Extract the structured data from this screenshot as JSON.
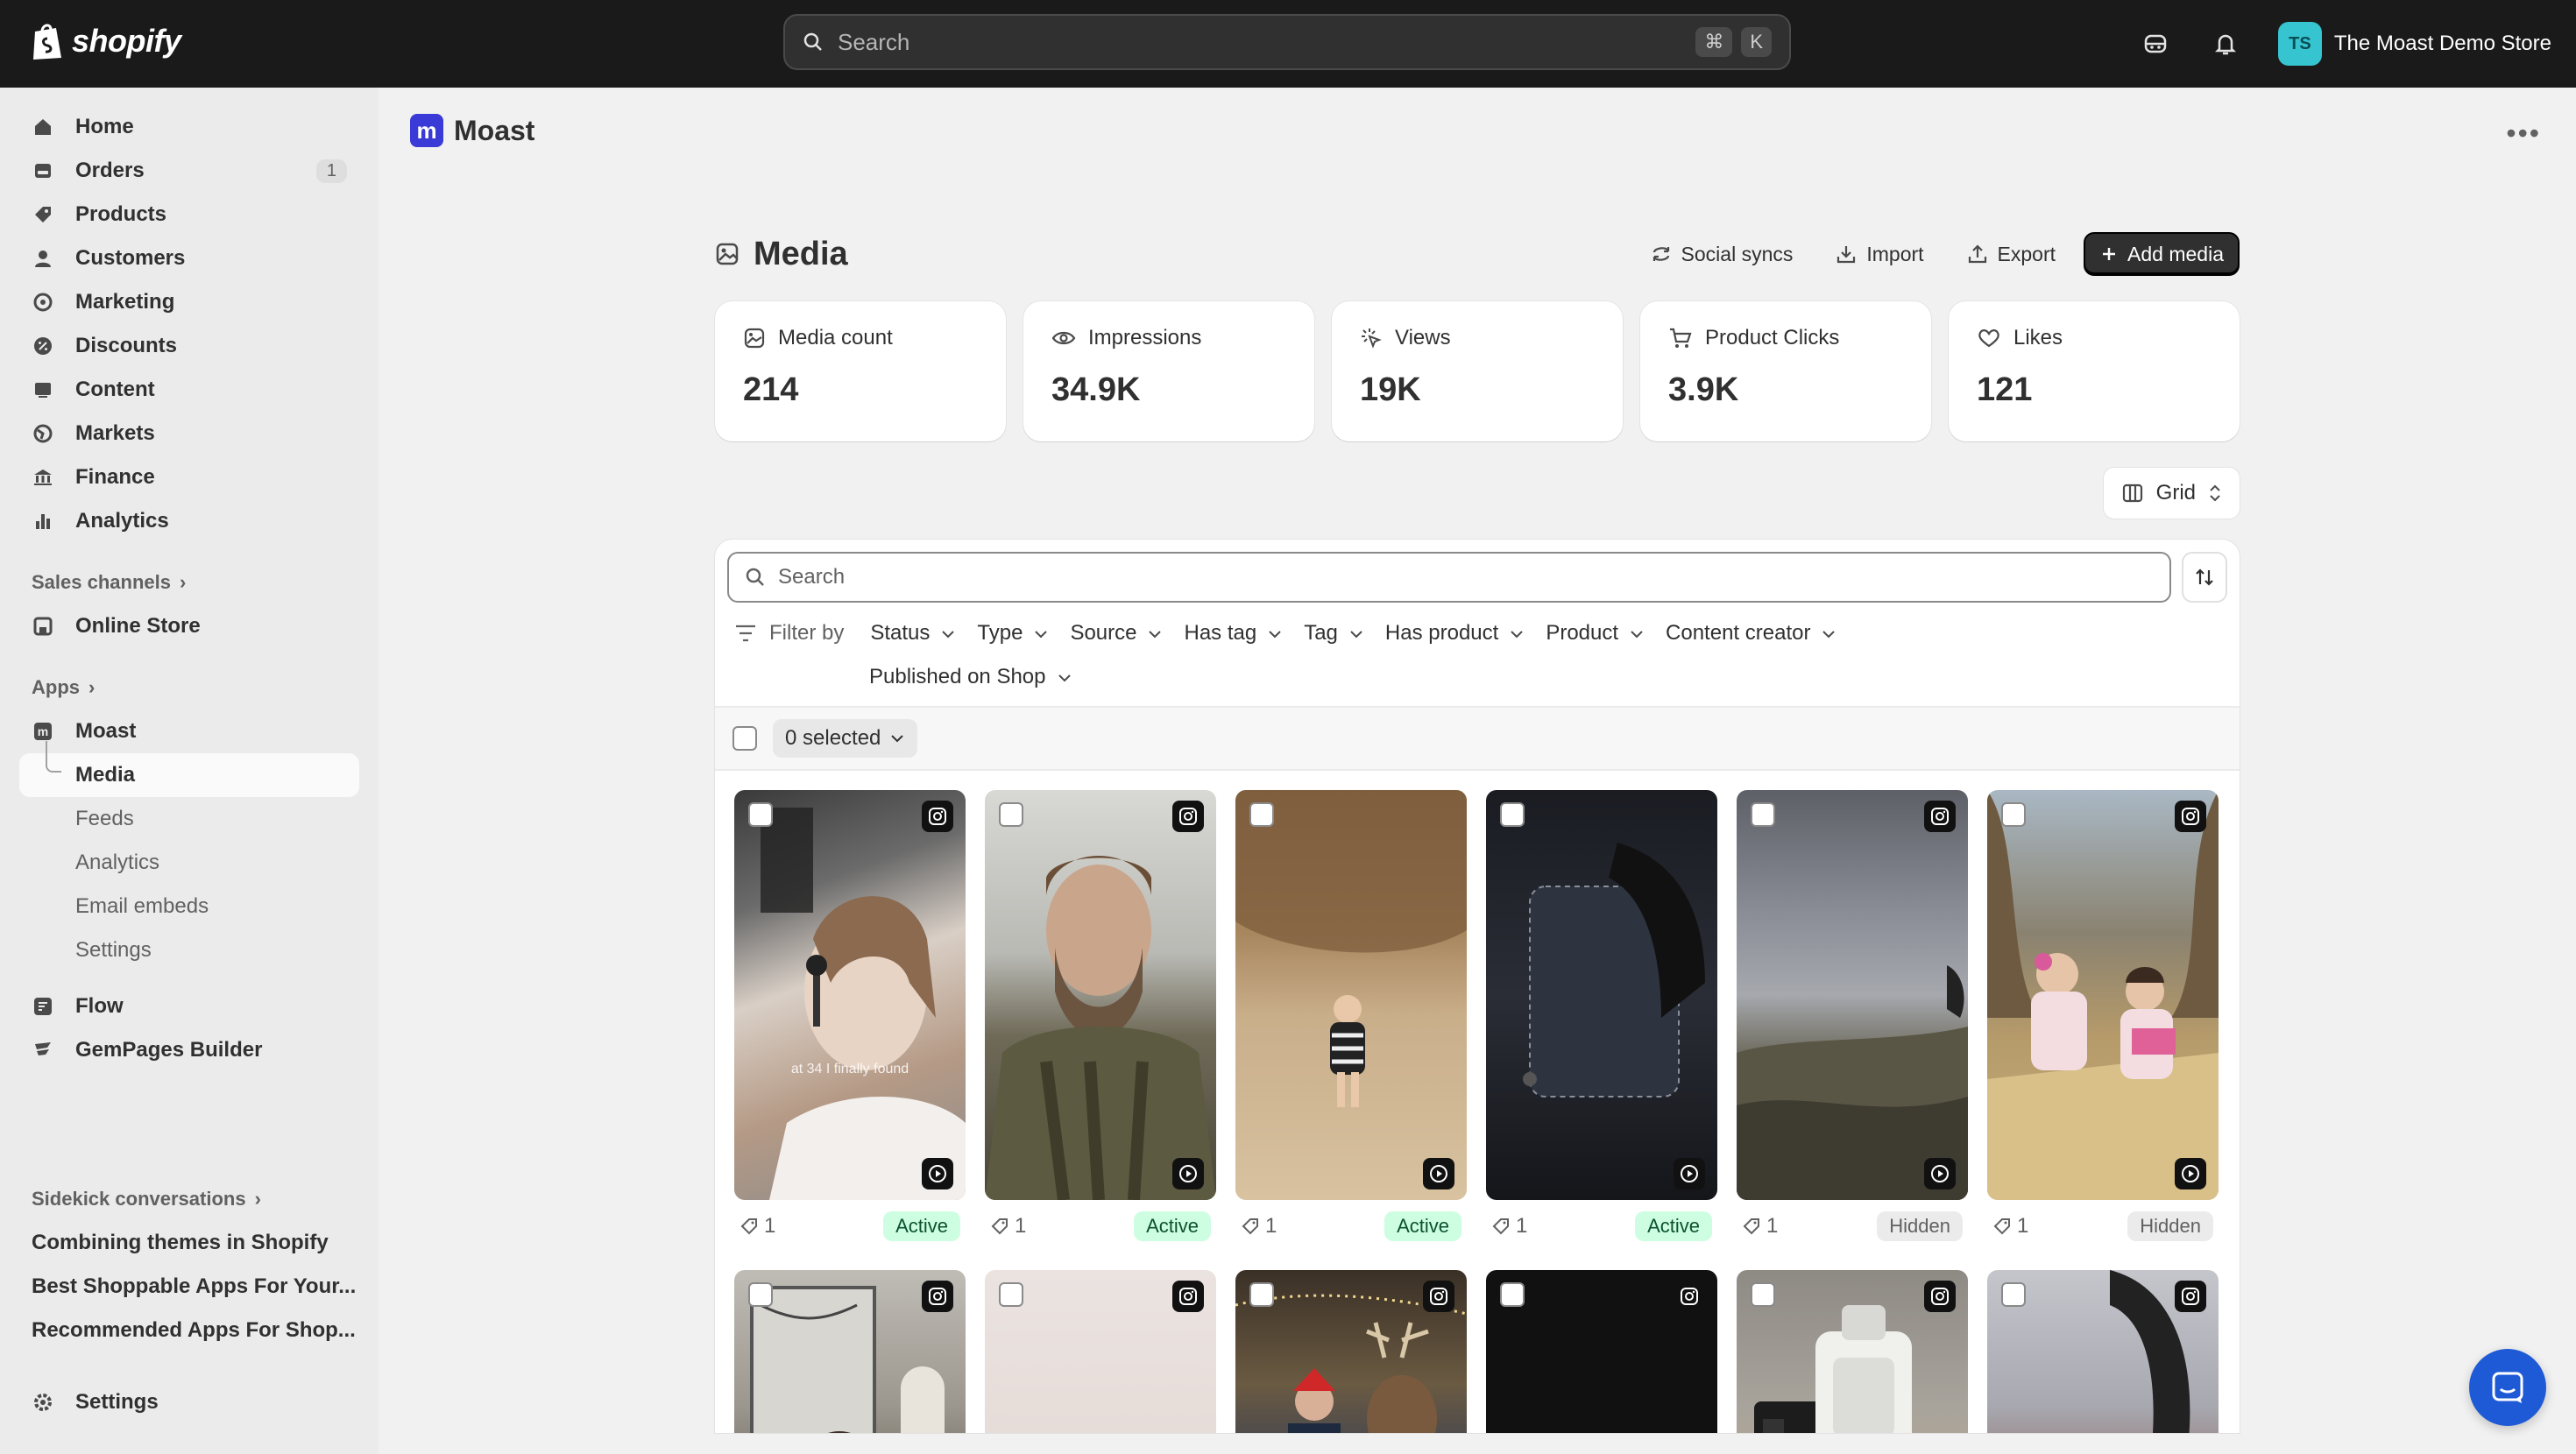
{
  "topbar": {
    "brand": "shopify",
    "search_placeholder": "Search",
    "shortcut_keys": [
      "⌘",
      "K"
    ],
    "store_initials": "TS",
    "store_name": "The Moast Demo Store"
  },
  "sidebar": {
    "items": [
      {
        "label": "Home",
        "icon": "home-icon"
      },
      {
        "label": "Orders",
        "icon": "orders-icon",
        "badge": "1"
      },
      {
        "label": "Products",
        "icon": "tag-icon"
      },
      {
        "label": "Customers",
        "icon": "person-icon"
      },
      {
        "label": "Marketing",
        "icon": "target-icon"
      },
      {
        "label": "Discounts",
        "icon": "discount-icon"
      },
      {
        "label": "Content",
        "icon": "content-icon"
      },
      {
        "label": "Markets",
        "icon": "globe-icon"
      },
      {
        "label": "Finance",
        "icon": "bank-icon"
      },
      {
        "label": "Analytics",
        "icon": "bar-chart-icon"
      }
    ],
    "sales_channels_label": "Sales channels",
    "online_store_label": "Online Store",
    "apps_label": "Apps",
    "moast_label": "Moast",
    "moast_sub": [
      "Media",
      "Feeds",
      "Analytics",
      "Email embeds",
      "Settings"
    ],
    "flow_label": "Flow",
    "gempages_label": "GemPages Builder",
    "sidekick_label": "Sidekick conversations",
    "conversations": [
      "Combining themes in Shopify",
      "Best Shoppable Apps For Your...",
      "Recommended Apps For Shop..."
    ],
    "settings_label": "Settings"
  },
  "app": {
    "logo_letter": "m",
    "title": "Moast"
  },
  "page": {
    "title": "Media",
    "actions": {
      "social_syncs": "Social syncs",
      "import": "Import",
      "export": "Export",
      "add_media": "Add media"
    },
    "stats": [
      {
        "label": "Media count",
        "value": "214"
      },
      {
        "label": "Impressions",
        "value": "34.9K"
      },
      {
        "label": "Views",
        "value": "19K"
      },
      {
        "label": "Product Clicks",
        "value": "3.9K"
      },
      {
        "label": "Likes",
        "value": "121"
      }
    ],
    "view_label": "Grid",
    "search_placeholder": "Search",
    "filter_by_label": "Filter by",
    "filters": [
      "Status",
      "Type",
      "Source",
      "Has tag",
      "Tag",
      "Has product",
      "Product",
      "Content creator",
      "Published on Shop"
    ],
    "selected_label": "0 selected"
  },
  "media": [
    {
      "tags": "1",
      "status": "Active",
      "overlay": "at 34 I finally found"
    },
    {
      "tags": "1",
      "status": "Active"
    },
    {
      "tags": "1",
      "status": "Active"
    },
    {
      "tags": "1",
      "status": "Active"
    },
    {
      "tags": "1",
      "status": "Hidden"
    },
    {
      "tags": "1",
      "status": "Hidden"
    }
  ],
  "colors": {
    "topbar": "#1a1a1a",
    "active_badge": "#cdfee1",
    "hidden_badge": "#ebebeb",
    "primary_button": "#303030",
    "chat_button": "#1f5ad6"
  }
}
